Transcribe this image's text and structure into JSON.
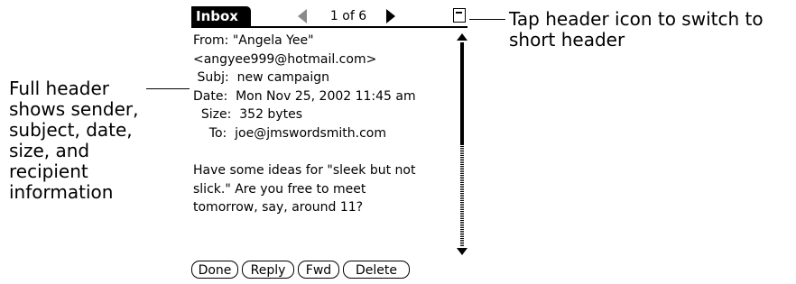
{
  "callouts": {
    "left": [
      "Full header",
      "shows sender,",
      "subject, date,",
      "size, and",
      "recipient",
      "information"
    ],
    "right": [
      "Tap header icon to switch to",
      "short header"
    ]
  },
  "titlebar": {
    "tab": "Inbox",
    "count": "1 of 6",
    "prev_icon": "left-arrow-icon",
    "next_icon": "right-arrow-icon",
    "header_toggle_icon": "header-icon"
  },
  "message": {
    "from_line1": "From: \"Angela Yee\"",
    "from_line2": "<angyee999@hotmail.com>",
    "subj": " Subj:  new campaign",
    "date": "Date:  Mon Nov 25, 2002 11:45 am",
    "size": "  Size:  352 bytes",
    "to": "    To:  joe@jmswordsmith.com",
    "body": [
      "Have some ideas for \"sleek but not",
      "slick.\" Are you free to meet",
      "tomorrow, say, around 11?"
    ]
  },
  "scrollbar": {
    "position": 0
  },
  "buttons": {
    "done": "Done",
    "reply": "Reply",
    "fwd": "Fwd",
    "delete": "Delete"
  }
}
